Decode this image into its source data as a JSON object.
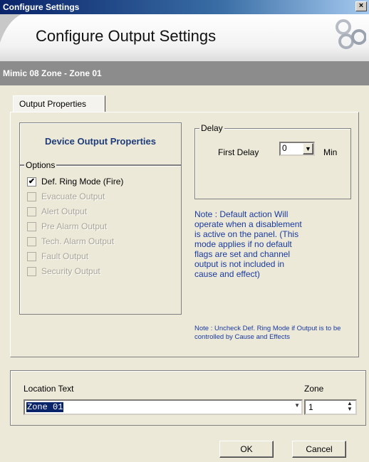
{
  "window": {
    "title": "Configure Settings",
    "close_glyph": "×"
  },
  "banner": {
    "heading": "Configure Output Settings",
    "logo_icon": "brand-logo-icon"
  },
  "subheader": {
    "text": "Mimic 08 Zone - Zone 01"
  },
  "tabs": [
    {
      "label": "Output Properties",
      "active": true
    }
  ],
  "device_output": {
    "label": "Device Output Properties"
  },
  "options": {
    "legend": "Options",
    "items": [
      {
        "label": "Def. Ring Mode (Fire)",
        "checked": true,
        "enabled": true
      },
      {
        "label": "Evacuate Output",
        "checked": false,
        "enabled": false
      },
      {
        "label": "Alert Output",
        "checked": false,
        "enabled": false
      },
      {
        "label": "Pre Alarm Output",
        "checked": false,
        "enabled": false
      },
      {
        "label": "Tech. Alarm Output",
        "checked": false,
        "enabled": false
      },
      {
        "label": "Fault Output",
        "checked": false,
        "enabled": false
      },
      {
        "label": "Security Output",
        "checked": false,
        "enabled": false
      }
    ]
  },
  "delay": {
    "legend": "Delay",
    "first_delay_label": "First Delay",
    "first_delay_value": "0",
    "unit": "Min"
  },
  "notes": {
    "note1": "Note : Default action Will operate when a disablement is active on the panel.  (This mode applies if no default flags are set and channel output is not included in cause and effect)",
    "note2": "Note : Uncheck Def. Ring Mode if Output is to be controlled by Cause and Effects"
  },
  "location": {
    "label": "Location Text",
    "value": "Zone 01",
    "zone_label": "Zone",
    "zone_value": "1"
  },
  "buttons": {
    "ok": "OK",
    "cancel": "Cancel"
  },
  "colors": {
    "note_text": "#1a3aa0",
    "heading_text": "#1f3d7a",
    "subheader_bg": "#8c8c8c"
  }
}
